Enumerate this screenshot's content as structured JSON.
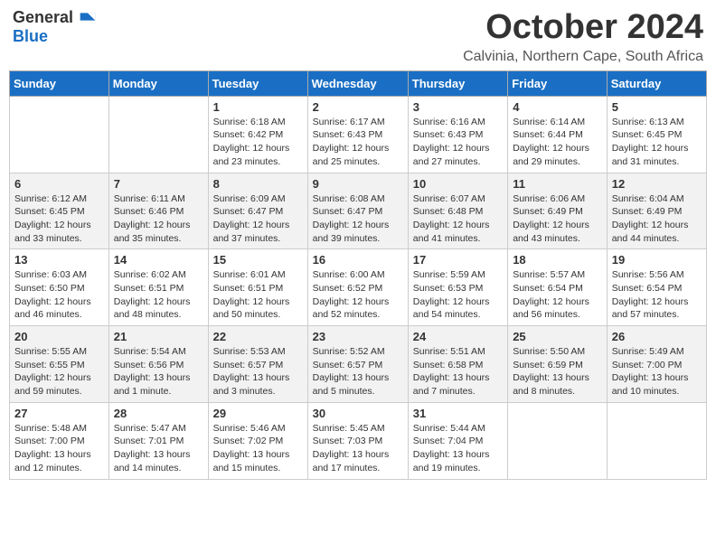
{
  "logo": {
    "general": "General",
    "blue": "Blue"
  },
  "title": {
    "month": "October 2024",
    "location": "Calvinia, Northern Cape, South Africa"
  },
  "weekdays": [
    "Sunday",
    "Monday",
    "Tuesday",
    "Wednesday",
    "Thursday",
    "Friday",
    "Saturday"
  ],
  "weeks": [
    [
      {
        "day": "",
        "info": ""
      },
      {
        "day": "",
        "info": ""
      },
      {
        "day": "1",
        "info": "Sunrise: 6:18 AM\nSunset: 6:42 PM\nDaylight: 12 hours\nand 23 minutes."
      },
      {
        "day": "2",
        "info": "Sunrise: 6:17 AM\nSunset: 6:43 PM\nDaylight: 12 hours\nand 25 minutes."
      },
      {
        "day": "3",
        "info": "Sunrise: 6:16 AM\nSunset: 6:43 PM\nDaylight: 12 hours\nand 27 minutes."
      },
      {
        "day": "4",
        "info": "Sunrise: 6:14 AM\nSunset: 6:44 PM\nDaylight: 12 hours\nand 29 minutes."
      },
      {
        "day": "5",
        "info": "Sunrise: 6:13 AM\nSunset: 6:45 PM\nDaylight: 12 hours\nand 31 minutes."
      }
    ],
    [
      {
        "day": "6",
        "info": "Sunrise: 6:12 AM\nSunset: 6:45 PM\nDaylight: 12 hours\nand 33 minutes."
      },
      {
        "day": "7",
        "info": "Sunrise: 6:11 AM\nSunset: 6:46 PM\nDaylight: 12 hours\nand 35 minutes."
      },
      {
        "day": "8",
        "info": "Sunrise: 6:09 AM\nSunset: 6:47 PM\nDaylight: 12 hours\nand 37 minutes."
      },
      {
        "day": "9",
        "info": "Sunrise: 6:08 AM\nSunset: 6:47 PM\nDaylight: 12 hours\nand 39 minutes."
      },
      {
        "day": "10",
        "info": "Sunrise: 6:07 AM\nSunset: 6:48 PM\nDaylight: 12 hours\nand 41 minutes."
      },
      {
        "day": "11",
        "info": "Sunrise: 6:06 AM\nSunset: 6:49 PM\nDaylight: 12 hours\nand 43 minutes."
      },
      {
        "day": "12",
        "info": "Sunrise: 6:04 AM\nSunset: 6:49 PM\nDaylight: 12 hours\nand 44 minutes."
      }
    ],
    [
      {
        "day": "13",
        "info": "Sunrise: 6:03 AM\nSunset: 6:50 PM\nDaylight: 12 hours\nand 46 minutes."
      },
      {
        "day": "14",
        "info": "Sunrise: 6:02 AM\nSunset: 6:51 PM\nDaylight: 12 hours\nand 48 minutes."
      },
      {
        "day": "15",
        "info": "Sunrise: 6:01 AM\nSunset: 6:51 PM\nDaylight: 12 hours\nand 50 minutes."
      },
      {
        "day": "16",
        "info": "Sunrise: 6:00 AM\nSunset: 6:52 PM\nDaylight: 12 hours\nand 52 minutes."
      },
      {
        "day": "17",
        "info": "Sunrise: 5:59 AM\nSunset: 6:53 PM\nDaylight: 12 hours\nand 54 minutes."
      },
      {
        "day": "18",
        "info": "Sunrise: 5:57 AM\nSunset: 6:54 PM\nDaylight: 12 hours\nand 56 minutes."
      },
      {
        "day": "19",
        "info": "Sunrise: 5:56 AM\nSunset: 6:54 PM\nDaylight: 12 hours\nand 57 minutes."
      }
    ],
    [
      {
        "day": "20",
        "info": "Sunrise: 5:55 AM\nSunset: 6:55 PM\nDaylight: 12 hours\nand 59 minutes."
      },
      {
        "day": "21",
        "info": "Sunrise: 5:54 AM\nSunset: 6:56 PM\nDaylight: 13 hours\nand 1 minute."
      },
      {
        "day": "22",
        "info": "Sunrise: 5:53 AM\nSunset: 6:57 PM\nDaylight: 13 hours\nand 3 minutes."
      },
      {
        "day": "23",
        "info": "Sunrise: 5:52 AM\nSunset: 6:57 PM\nDaylight: 13 hours\nand 5 minutes."
      },
      {
        "day": "24",
        "info": "Sunrise: 5:51 AM\nSunset: 6:58 PM\nDaylight: 13 hours\nand 7 minutes."
      },
      {
        "day": "25",
        "info": "Sunrise: 5:50 AM\nSunset: 6:59 PM\nDaylight: 13 hours\nand 8 minutes."
      },
      {
        "day": "26",
        "info": "Sunrise: 5:49 AM\nSunset: 7:00 PM\nDaylight: 13 hours\nand 10 minutes."
      }
    ],
    [
      {
        "day": "27",
        "info": "Sunrise: 5:48 AM\nSunset: 7:00 PM\nDaylight: 13 hours\nand 12 minutes."
      },
      {
        "day": "28",
        "info": "Sunrise: 5:47 AM\nSunset: 7:01 PM\nDaylight: 13 hours\nand 14 minutes."
      },
      {
        "day": "29",
        "info": "Sunrise: 5:46 AM\nSunset: 7:02 PM\nDaylight: 13 hours\nand 15 minutes."
      },
      {
        "day": "30",
        "info": "Sunrise: 5:45 AM\nSunset: 7:03 PM\nDaylight: 13 hours\nand 17 minutes."
      },
      {
        "day": "31",
        "info": "Sunrise: 5:44 AM\nSunset: 7:04 PM\nDaylight: 13 hours\nand 19 minutes."
      },
      {
        "day": "",
        "info": ""
      },
      {
        "day": "",
        "info": ""
      }
    ]
  ]
}
